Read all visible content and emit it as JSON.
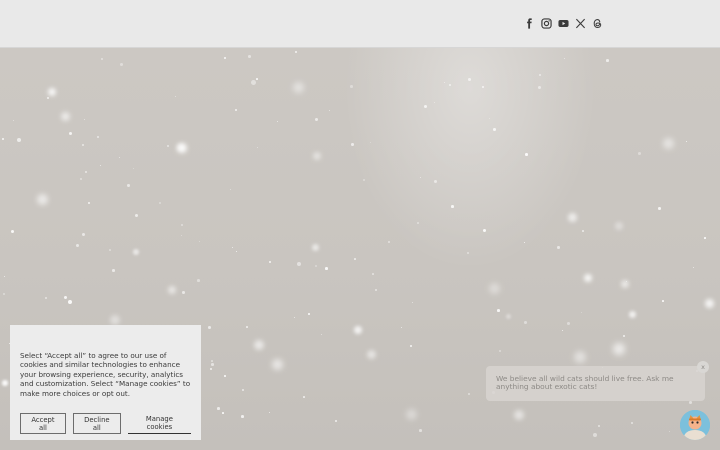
{
  "header": {
    "social": [
      {
        "name": "facebook-icon",
        "label": "Facebook"
      },
      {
        "name": "instagram-icon",
        "label": "Instagram"
      },
      {
        "name": "youtube-icon",
        "label": "YouTube"
      },
      {
        "name": "x-icon",
        "label": "X"
      },
      {
        "name": "threads-icon",
        "label": "Threads"
      }
    ]
  },
  "cookie": {
    "text": "Select “Accept all” to agree to our use of cookies and similar technologies to enhance your browsing experience, security, analytics and customization. Select “Manage cookies” to make more choices or opt out.",
    "accept_label": "Accept all",
    "decline_label": "Decline all",
    "manage_label": "Manage cookies"
  },
  "chat": {
    "message": "We believe all wild cats should live free. Ask me anything about exotic cats!",
    "close_label": "x"
  },
  "colors": {
    "header_bg": "#e9e9e9",
    "hero_bg": "#cfcbc6",
    "cookie_bg": "#ececec",
    "snow": "#ffffff"
  }
}
